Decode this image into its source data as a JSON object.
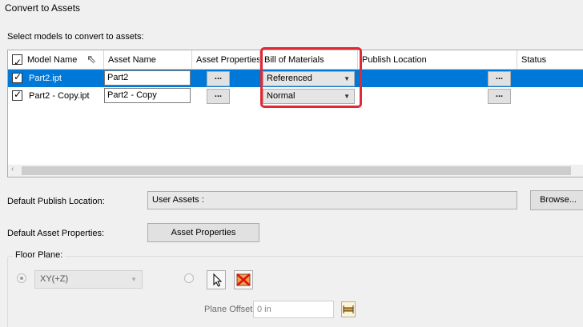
{
  "dialog": {
    "title": "Convert to Assets",
    "select_label": "Select models to convert to assets:"
  },
  "grid": {
    "columns": [
      "Model Name",
      "Asset Name",
      "Asset Properties",
      "Bill of Materials",
      "Publish Location",
      "Status"
    ],
    "rows": [
      {
        "checked": true,
        "model": "Part2.ipt",
        "asset": "Part2",
        "props_button": "...",
        "bom": "Referenced",
        "publish_button": "...",
        "status": "",
        "selected": true
      },
      {
        "checked": true,
        "model": "Part2 - Copy.ipt",
        "asset": "Part2 - Copy",
        "props_button": "...",
        "bom": "Normal",
        "publish_button": "...",
        "status": "",
        "selected": false
      }
    ]
  },
  "publish": {
    "label": "Default Publish Location:",
    "value": "User Assets :",
    "browse_label": "Browse..."
  },
  "asset_props": {
    "label": "Default Asset Properties:",
    "button_label": "Asset Properties"
  },
  "floor_plane": {
    "group_label": "Floor Plane:",
    "plane_option": "XY(+Z)",
    "offset_label": "Plane Offset",
    "offset_value": "0 in"
  },
  "colors": {
    "selection": "#0078d7",
    "highlight_box": "#e02935"
  }
}
